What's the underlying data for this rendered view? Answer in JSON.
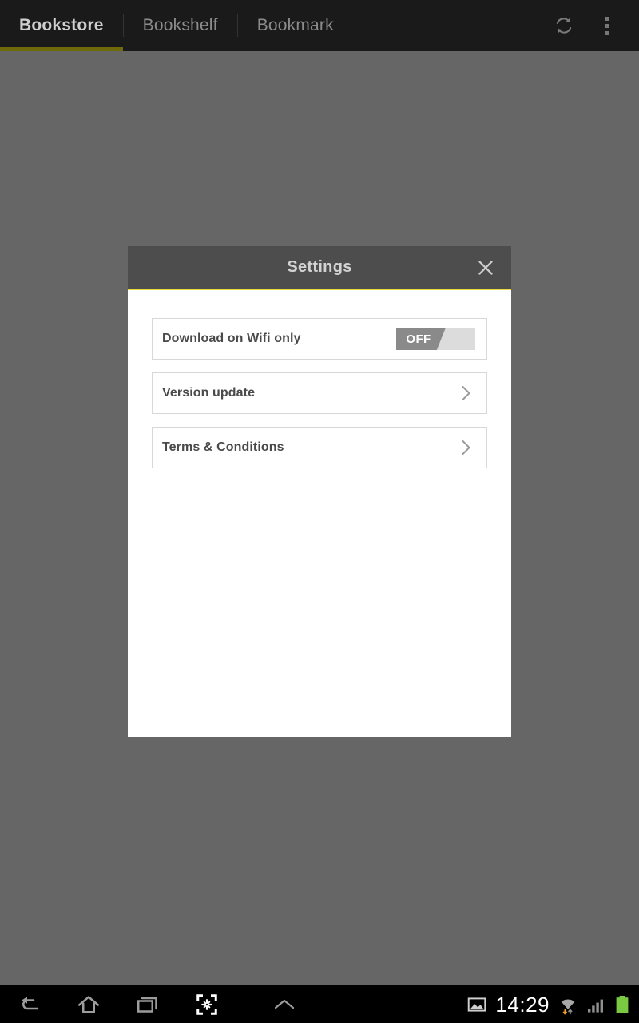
{
  "topbar": {
    "tabs": [
      {
        "label": "Bookstore",
        "active": true
      },
      {
        "label": "Bookshelf",
        "active": false
      },
      {
        "label": "Bookmark",
        "active": false
      }
    ],
    "actions": [
      {
        "name": "refresh-icon",
        "label": "Refresh"
      },
      {
        "name": "overflow-menu-icon",
        "label": "More options"
      }
    ],
    "active_tab_accent": "#6e6a0c",
    "background": "#1a1a1a"
  },
  "dialog": {
    "title": "Settings",
    "close_label": "Close",
    "header_background": "#4d4d4d",
    "accent_line": "#e9dc3d",
    "body_background": "#ffffff",
    "rows": [
      {
        "label": "Download on Wifi only",
        "control": "toggle",
        "toggle_value": "OFF",
        "toggle_on_color": "#8a8a8a",
        "toggle_off_color": "#dcdcdc"
      },
      {
        "label": "Version update",
        "control": "chevron"
      },
      {
        "label": "Terms & Conditions",
        "control": "chevron"
      }
    ]
  },
  "navbar": {
    "buttons": [
      {
        "name": "back-icon",
        "label": "Back"
      },
      {
        "name": "home-icon",
        "label": "Home"
      },
      {
        "name": "recents-icon",
        "label": "Recent apps"
      },
      {
        "name": "screenshot-icon",
        "label": "Screenshot"
      },
      {
        "name": "chevron-up-icon",
        "label": "Expand"
      }
    ],
    "status": {
      "screenshot_notification": "screenshot-notification-icon",
      "time": "14:29",
      "wifi": "wifi-icon",
      "signal": "signal-icon",
      "battery": "battery-icon",
      "battery_color": "#7ac943"
    }
  },
  "background_color": "#666666"
}
